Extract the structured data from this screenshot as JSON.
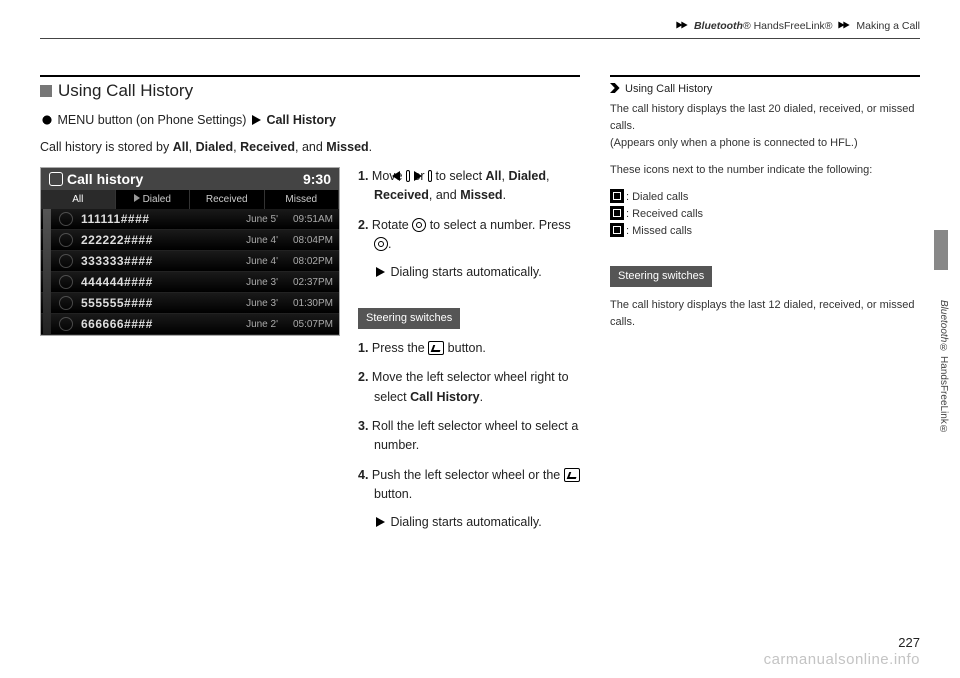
{
  "breadcrumb": {
    "a": "Bluetooth",
    "b": "® HandsFreeLink®",
    "c": "Making a Call"
  },
  "section_heading": "Using Call History",
  "menu_path": {
    "btn": "MENU button (on Phone Settings)",
    "dest": "Call History"
  },
  "intro": {
    "pre": "Call history is stored by ",
    "a": "All",
    "b": "Dialed",
    "c": "Received",
    "d": "Missed",
    "end": "."
  },
  "screen": {
    "title": "Call history",
    "clock": "9:30",
    "tabs": [
      "All",
      "Dialed",
      "Received",
      "Missed"
    ],
    "rows": [
      {
        "num": "111111####",
        "date": "June 5'",
        "time": "09:51AM"
      },
      {
        "num": "222222####",
        "date": "June 4'",
        "time": "08:04PM"
      },
      {
        "num": "333333####",
        "date": "June 4'",
        "time": "08:02PM"
      },
      {
        "num": "444444####",
        "date": "June 3'",
        "time": "02:37PM"
      },
      {
        "num": "555555####",
        "date": "June 3'",
        "time": "01:30PM"
      },
      {
        "num": "666666####",
        "date": "June 2'",
        "time": "05:07PM"
      }
    ]
  },
  "steps": {
    "s1a": "Move ",
    "s1b": " or ",
    "s1c": " to select ",
    "s1all": "All",
    "s1d": "Dialed",
    "s1r": "Received",
    "s1m": "Missed",
    "s1end": ".",
    "s2a": "Rotate ",
    "s2b": " to select a number. Press ",
    "s2c": ".",
    "s2note": "Dialing starts automatically."
  },
  "steering_label": "Steering switches",
  "steer": {
    "s1a": "Press the ",
    "s1b": " button.",
    "s2a": "Move the left selector wheel right to select ",
    "s2b": "Call History",
    "s2c": ".",
    "s3": "Roll the left selector wheel to select a number.",
    "s4a": "Push the left selector wheel or the ",
    "s4b": " button.",
    "s4note": "Dialing starts automatically."
  },
  "side": {
    "title": "Using Call History",
    "p1": "The call history displays the last 20 dialed, received, or missed calls.",
    "p1b": "(Appears only when a phone is connected to HFL.)",
    "p2": "These icons next to the number indicate the following:",
    "l1": ": Dialed calls",
    "l2": ": Received calls",
    "l3": ": Missed calls",
    "steer_label": "Steering switches",
    "p3": "The call history displays the last 12 dialed, received, or missed calls."
  },
  "side_label": {
    "a": "Bluetooth",
    "b": "® HandsFreeLink®"
  },
  "page_no": "227",
  "watermark": "carmanualsonline.info"
}
